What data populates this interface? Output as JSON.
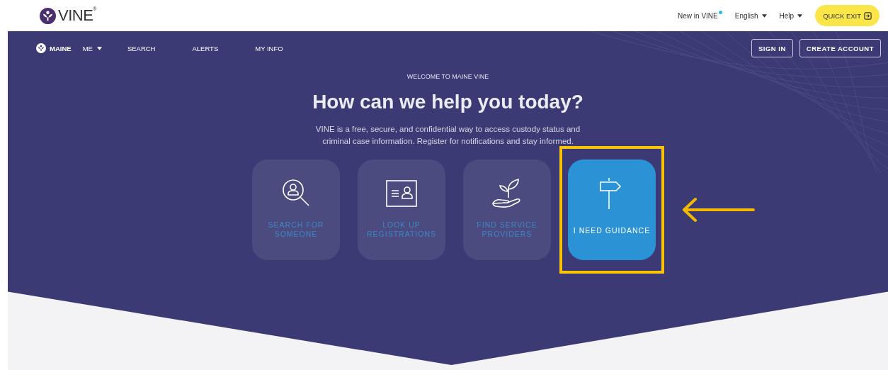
{
  "header": {
    "logo_text": "VINE",
    "logo_mark": "®",
    "links": [
      {
        "label": "New in VINE",
        "kind": "badge"
      },
      {
        "label": "English",
        "kind": "dropdown"
      },
      {
        "label": "Help",
        "kind": "dropdown"
      }
    ],
    "quick_exit": "QUICK EXIT"
  },
  "nav": {
    "state": "MAINE",
    "items": [
      {
        "label": "ME",
        "kind": "dropdown"
      },
      {
        "label": "SEARCH",
        "kind": "link"
      },
      {
        "label": "ALERTS",
        "kind": "link"
      },
      {
        "label": "MY INFO",
        "kind": "link"
      }
    ],
    "buttons": [
      "SIGN IN",
      "CREATE ACCOUNT"
    ]
  },
  "hero": {
    "eyebrow": "WELCOME TO MAINE VINE",
    "title": "How can we help you today?",
    "description": "VINE is a free, secure, and confidential way to access custody status and criminal case information. Register for notifications and stay informed.",
    "cards": [
      {
        "lines": [
          "SEARCH FOR",
          "SOMEONE"
        ],
        "selected": false,
        "highlighted": false
      },
      {
        "lines": [
          "LOOK UP",
          "REGISTRATIONS"
        ],
        "selected": false,
        "highlighted": false
      },
      {
        "lines": [
          "FIND SERVICE",
          "PROVIDERS"
        ],
        "selected": false,
        "highlighted": false
      },
      {
        "lines": [
          "I NEED GUIDANCE"
        ],
        "selected": true,
        "highlighted": true
      }
    ]
  }
}
